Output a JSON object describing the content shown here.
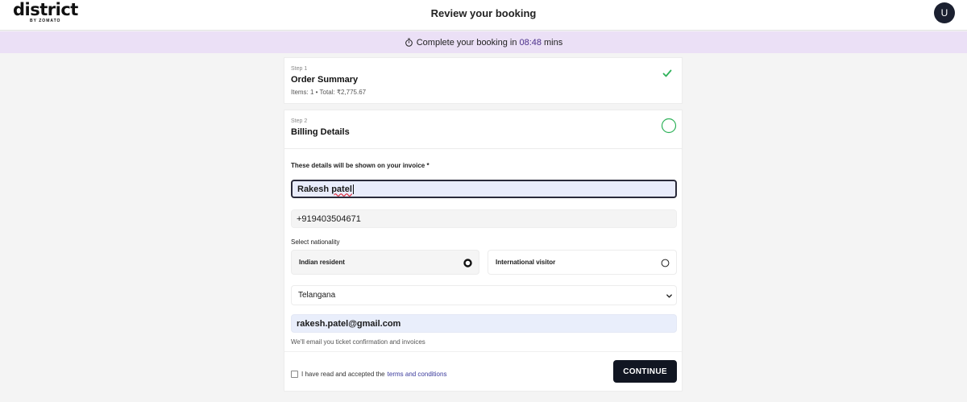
{
  "header": {
    "logo_text": "district",
    "logo_sub": "BY ZOMATO",
    "title": "Review your booking",
    "avatar_initial": "U"
  },
  "timer": {
    "prefix": "Complete your booking in",
    "time": "08:48",
    "suffix": "mins"
  },
  "step1": {
    "label": "Step 1",
    "title": "Order Summary",
    "meta": "Items: 1 • Total: ₹2,775.67",
    "status": "complete"
  },
  "step2": {
    "label": "Step 2",
    "title": "Billing Details",
    "status": "in-progress",
    "invoice_label": "These details will be shown on your invoice *",
    "name_first": "Rakesh",
    "name_last": "patel",
    "phone": "+919403504671",
    "nationality_label": "Select nationality",
    "nationality_options": [
      "Indian resident",
      "International visitor"
    ],
    "nationality_selected": "Indian resident",
    "state": "Telangana",
    "email": "rakesh.patel@gmail.com",
    "email_helper": "We'll email you ticket confirmation and invoices",
    "terms_text": "I have read and accepted the",
    "terms_link": "terms and conditions",
    "continue_label": "CONTINUE"
  },
  "colors": {
    "banner": "#ebe0f6",
    "accent_purple": "#4a2f8a",
    "success_green": "#2fb25a",
    "button_dark": "#111622"
  }
}
